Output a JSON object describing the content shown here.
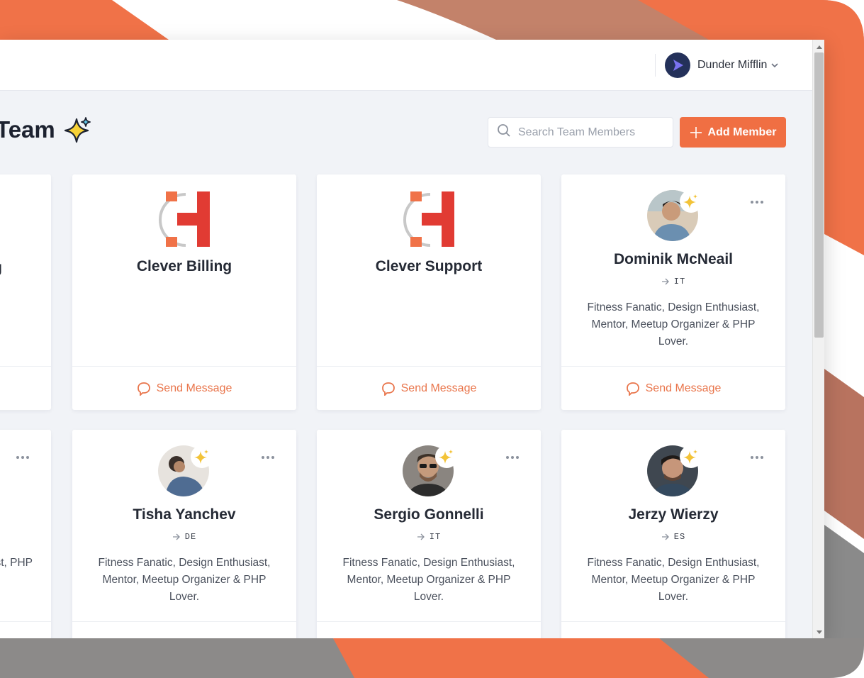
{
  "header": {
    "org_name": "Dunder Mifflin"
  },
  "page": {
    "title": "Team",
    "search_placeholder": "Search Team Members",
    "add_label": "Add Member"
  },
  "colors": {
    "accent": "#f06f43",
    "link": "#e9754b",
    "background": "#f1f3f7"
  },
  "cards": [
    {
      "type": "team",
      "name": "g",
      "footer": ""
    },
    {
      "type": "team",
      "name": "Clever Billing",
      "footer": "Send Message"
    },
    {
      "type": "team",
      "name": "Clever Support",
      "footer": "Send Message"
    },
    {
      "type": "member",
      "name": "Dominik McNeail",
      "location": "IT",
      "bio": "Fitness Fanatic, Design Enthusiast, Mentor, Meetup Organizer & PHP Lover.",
      "footer": "Send Message"
    },
    {
      "type": "member",
      "name": "",
      "location": "",
      "bio": "usiast, PHP",
      "footer": ""
    },
    {
      "type": "member",
      "name": "Tisha Yanchev",
      "location": "DE",
      "bio": "Fitness Fanatic, Design Enthusiast, Mentor, Meetup Organizer & PHP Lover.",
      "footer": ""
    },
    {
      "type": "member",
      "name": "Sergio Gonnelli",
      "location": "IT",
      "bio": "Fitness Fanatic, Design Enthusiast, Mentor, Meetup Organizer & PHP Lover.",
      "footer": ""
    },
    {
      "type": "member",
      "name": "Jerzy Wierzy",
      "location": "ES",
      "bio": "Fitness Fanatic, Design Enthusiast, Mentor, Meetup Organizer & PHP Lover.",
      "footer": ""
    }
  ],
  "icons": {
    "search": "search-icon",
    "plus": "plus-icon",
    "message": "message-icon",
    "more": "more-dots-icon",
    "sparkle": "sparkles-icon",
    "arrow": "arrow-right-icon",
    "chevron": "chevron-down-icon",
    "org_logo": "play-logo-icon"
  }
}
